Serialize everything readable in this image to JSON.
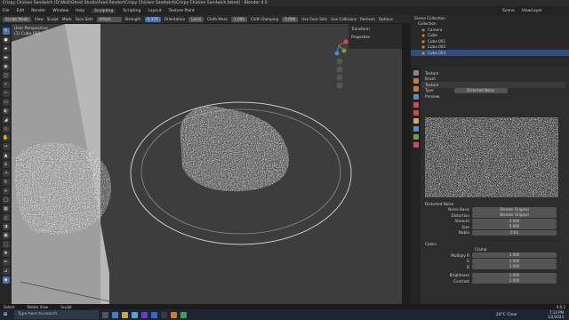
{
  "window_title": "Crispy Chicken Sandwich (D:\\Woll\\Ghost Studio\\Food Render\\Crispy Chicken Sandwich\\Crispy Chicken Sandwich.blend) - Blender 4.0",
  "menu": [
    "File",
    "Edit",
    "Render",
    "Window",
    "Help"
  ],
  "workspaces": [
    "Sculpting",
    "Scripting",
    "Layout",
    "Texture Paint"
  ],
  "scene_label": "Scene",
  "view_layer": "ViewLayer",
  "header": {
    "mode": "Sculpt Mode",
    "view": "View",
    "sculpt": "Sculpt",
    "mask": "Mask",
    "face_sets": "Face Sets",
    "brush": "Inflate",
    "strength_label": "Strength",
    "strength": "0.376",
    "orientation_label": "Orientation",
    "orientation": "Local",
    "cloth_mass_label": "Cloth Mass",
    "cloth_mass": "1.000",
    "cloth_damping_label": "Cloth Damping",
    "cloth_damping": "0.000",
    "use_face_sets": "Use Face Sets",
    "use_collisions": "Use Collisions",
    "remesh": "Remesh",
    "options": "Options"
  },
  "viewport": {
    "view_name": "User Perspective",
    "object": "(1) Cube.003"
  },
  "sidetabs": [
    "Transform",
    "Properties"
  ],
  "outliner": [
    {
      "name": "Scene Collection",
      "sel": false
    },
    {
      "name": "Collection",
      "sel": false
    },
    {
      "name": "Camera",
      "sel": false
    },
    {
      "name": "Cube",
      "sel": false
    },
    {
      "name": "Cube.001",
      "sel": false
    },
    {
      "name": "Cube.002",
      "sel": false
    },
    {
      "name": "Cube.003",
      "sel": true
    }
  ],
  "props": {
    "texture": "Texture",
    "brush": "Brush",
    "tex_name": "Texture",
    "type_label": "Type",
    "type": "Distorted Noise",
    "preview": "Preview",
    "section": "Distorted Noise",
    "noise_basis_label": "Noise Basis",
    "noise_basis": "Blender Original",
    "distortion_label": "Distortion",
    "distortion": "Blender Original",
    "amount_label": "Amount",
    "amount": "0.000",
    "size_label": "Size",
    "size": "0.000",
    "nabla_label": "Nabla",
    "nabla": "0.03",
    "colors": "Colors",
    "clamp": "Clamp",
    "multiply_r": "1.000",
    "g": "1.000",
    "b": "1.000",
    "brightness": "1.000",
    "contrast": "1.000"
  },
  "status": {
    "select": "Select",
    "rotate": "Rotate View",
    "sculpt": "Sculpt",
    "version": "4.0.2"
  },
  "taskbar": {
    "search": "Type here to search",
    "weather": "24°C  Clear",
    "time": "7:14 PM",
    "date": "1/2/2024"
  }
}
